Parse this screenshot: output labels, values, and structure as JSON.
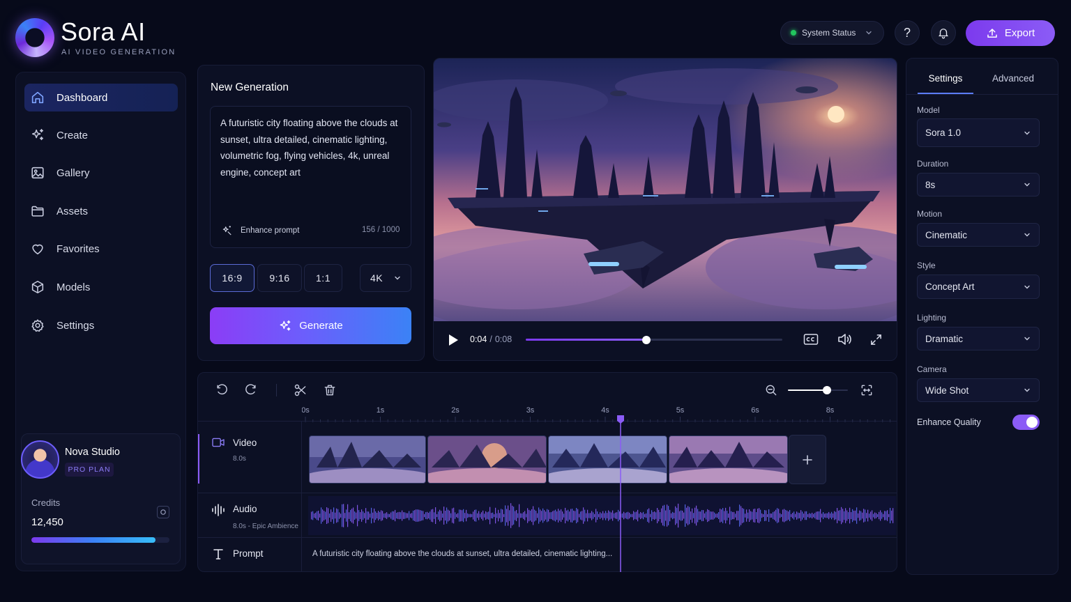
{
  "app": {
    "name": "Sora AI",
    "subtitle": "AI VIDEO GENERATION"
  },
  "header": {
    "status_label": "System Status",
    "export_label": "Export",
    "help_icon": "help-icon",
    "notification_icon": "bell-icon"
  },
  "sidebar": {
    "items": [
      {
        "label": "Dashboard",
        "icon": "home-icon",
        "active": true
      },
      {
        "label": "Create",
        "icon": "sparkles-icon"
      },
      {
        "label": "Gallery",
        "icon": "image-icon"
      },
      {
        "label": "Assets",
        "icon": "folder-icon"
      },
      {
        "label": "Favorites",
        "icon": "heart-icon"
      },
      {
        "label": "Models",
        "icon": "cube-icon"
      },
      {
        "label": "Settings",
        "icon": "gear-icon"
      }
    ],
    "profile": {
      "name": "Nova Studio",
      "plan": "PRO PLAN"
    },
    "credits": {
      "label": "Credits",
      "value": "12,450",
      "fill_percent": 90
    }
  },
  "generation": {
    "title": "New Generation",
    "prompt": "A futuristic city floating above the clouds at sunset, ultra detailed, cinematic lighting, volumetric fog, flying vehicles, 4k, unreal engine, concept art",
    "enhance_label": "Enhance prompt",
    "char_count": "156 / 1000",
    "ratios": [
      "16:9",
      "9:16",
      "1:1"
    ],
    "active_ratio": "16:9",
    "resolution": "4K",
    "generate_label": "Generate"
  },
  "player": {
    "current_time": "0:04",
    "separator": "/",
    "duration": "0:08",
    "progress_percent": 47
  },
  "timeline": {
    "ticks": [
      "0s",
      "1s",
      "2s",
      "3s",
      "4s",
      "5s",
      "6s",
      "8s"
    ],
    "playhead_seconds": 4.2,
    "tracks": {
      "video": {
        "label": "Video",
        "sub": "8.0s"
      },
      "audio": {
        "label": "Audio",
        "sub": "8.0s - Epic Ambience"
      },
      "prompt": {
        "label": "Prompt",
        "text": "A futuristic city floating above the clouds at sunset, ultra detailed, cinematic lighting..."
      }
    },
    "zoom_percent": 65
  },
  "settings": {
    "tabs": [
      "Settings",
      "Advanced"
    ],
    "active_tab": "Settings",
    "fields": [
      {
        "label": "Model",
        "value": "Sora 1.0"
      },
      {
        "label": "Duration",
        "value": "8s"
      },
      {
        "label": "Motion",
        "value": "Cinematic"
      },
      {
        "label": "Style",
        "value": "Concept Art"
      },
      {
        "label": "Lighting",
        "value": "Dramatic"
      },
      {
        "label": "Camera",
        "value": "Wide Shot"
      }
    ],
    "enhance_quality": {
      "label": "Enhance Quality",
      "enabled": true
    }
  },
  "colors": {
    "accent": "#8b5cf6",
    "accent_blue": "#3b82f6",
    "status_ok": "#22c55e",
    "background": "#070a1a"
  }
}
